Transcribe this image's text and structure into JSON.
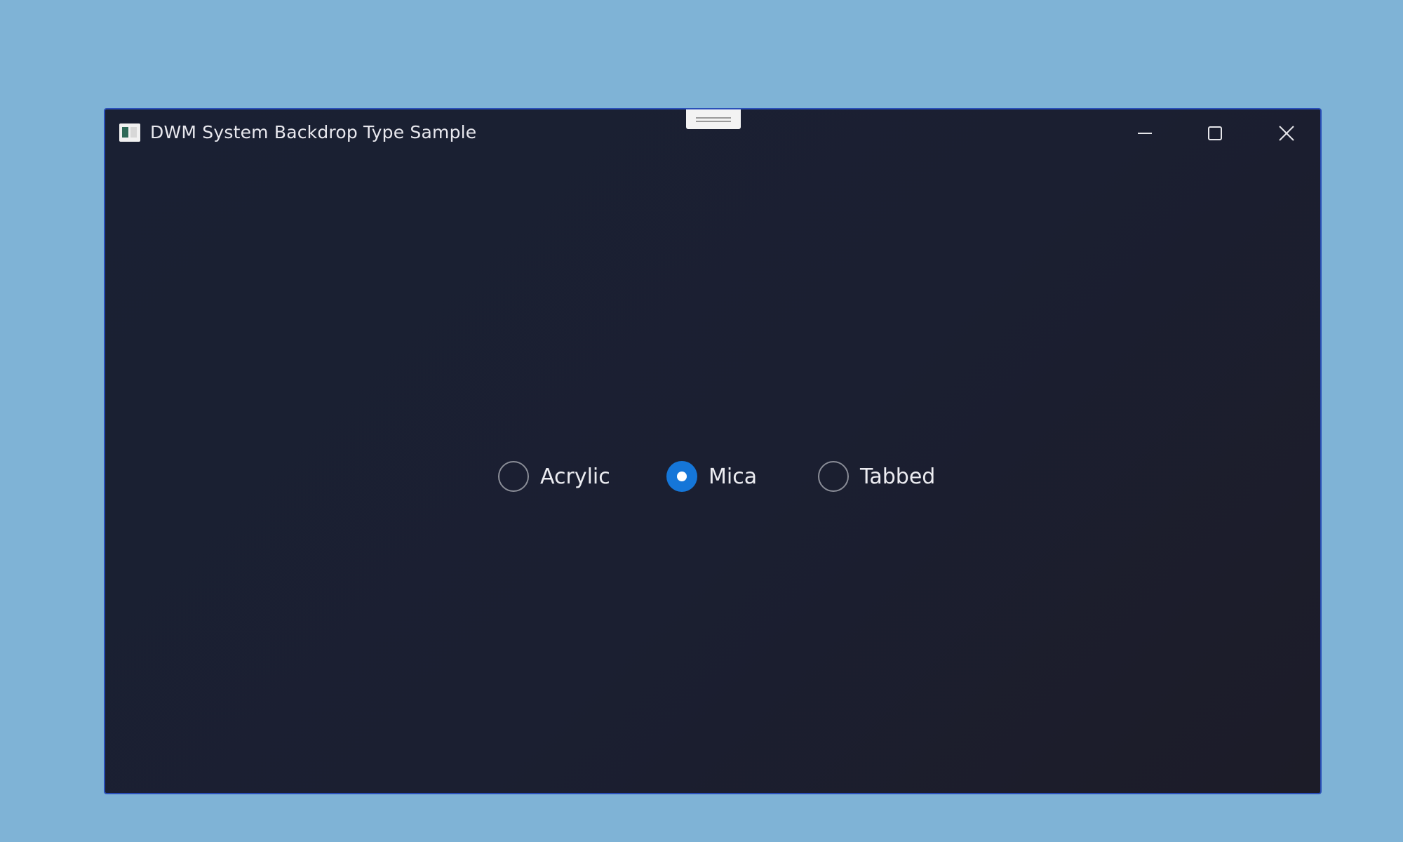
{
  "window": {
    "title": "DWM System Backdrop Type Sample",
    "icons": {
      "app": "app-window-icon",
      "minimize": "minimize-icon",
      "maximize": "maximize-icon",
      "close": "close-icon"
    }
  },
  "backdrop_options": {
    "acrylic": {
      "label": "Acrylic",
      "checked": false
    },
    "mica": {
      "label": "Mica",
      "checked": true
    },
    "tabbed": {
      "label": "Tabbed",
      "checked": false
    }
  },
  "colors": {
    "desktop": "#7fb3d6",
    "window_bg": "#1a1f32",
    "window_border": "#2a4fb8",
    "accent": "#1576d8",
    "text": "#ececf1"
  }
}
